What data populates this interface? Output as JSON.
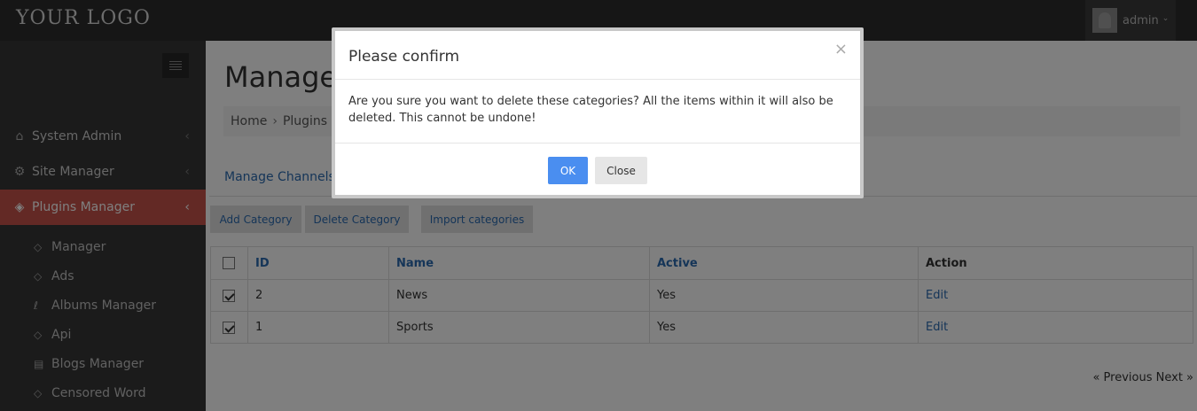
{
  "header": {
    "logo": "YOUR LOGO",
    "user_name": "admin"
  },
  "sidebar": {
    "items": [
      {
        "label": "System Admin",
        "icon": "home-icon"
      },
      {
        "label": "Site Manager",
        "icon": "gears-icon"
      },
      {
        "label": "Plugins Manager",
        "icon": "plugin-tag-icon",
        "active": true
      }
    ],
    "sub_items": [
      {
        "label": "Manager",
        "icon": "plugin-tag-icon"
      },
      {
        "label": "Ads",
        "icon": "plugin-tag-icon"
      },
      {
        "label": "Albums Manager",
        "icon": "albums-icon"
      },
      {
        "label": "Api",
        "icon": "plugin-tag-icon"
      },
      {
        "label": "Blogs Manager",
        "icon": "blogs-icon"
      },
      {
        "label": "Censored Word",
        "icon": "plugin-tag-icon"
      }
    ]
  },
  "main": {
    "title": "Manage C",
    "breadcrumb": [
      "Home",
      "Plugins M"
    ],
    "tab_link": "Manage Channels",
    "buttons": {
      "add": "Add Category",
      "delete": "Delete Category",
      "import": "Import categories"
    },
    "table": {
      "headers": [
        "ID",
        "Name",
        "Active",
        "Action"
      ],
      "rows": [
        {
          "id": "2",
          "name": "News",
          "active": "Yes",
          "action": "Edit",
          "checked": true
        },
        {
          "id": "1",
          "name": "Sports",
          "active": "Yes",
          "action": "Edit",
          "checked": true
        }
      ]
    },
    "pager": {
      "previous": "« Previous",
      "next": "Next »"
    }
  },
  "modal": {
    "title": "Please confirm",
    "close_symbol": "×",
    "message": "Are you sure you want to delete these categories? All the items within it will also be deleted. This cannot be undone!",
    "ok_label": "OK",
    "close_label": "Close"
  },
  "colors": {
    "accent": "#c6534a",
    "primary_button": "#4a8ef0",
    "link": "#2a6ab0",
    "topbar": "#2c2c2c",
    "sidebar": "#363636"
  }
}
